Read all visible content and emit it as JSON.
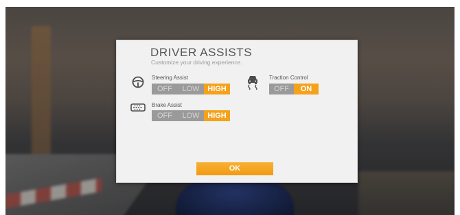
{
  "dialog": {
    "title": "DRIVER ASSISTS",
    "subtitle": "Customize your driving experience."
  },
  "assists": {
    "steering": {
      "label": "Steering Assist",
      "icon": "steering-wheel-icon",
      "options": [
        "OFF",
        "LOW",
        "HIGH"
      ],
      "selected": "HIGH"
    },
    "brake": {
      "label": "Brake Assist",
      "icon": "brake-pedal-icon",
      "options": [
        "OFF",
        "LOW",
        "HIGH"
      ],
      "selected": "HIGH"
    },
    "traction": {
      "label": "Traction Control",
      "icon": "traction-car-icon",
      "options": [
        "OFF",
        "ON"
      ],
      "selected": "ON"
    }
  },
  "actions": {
    "ok_label": "OK"
  },
  "colors": {
    "accent": "#f4a21b",
    "inactive": "#9a9a9a",
    "panel": "#f1f1f1"
  }
}
